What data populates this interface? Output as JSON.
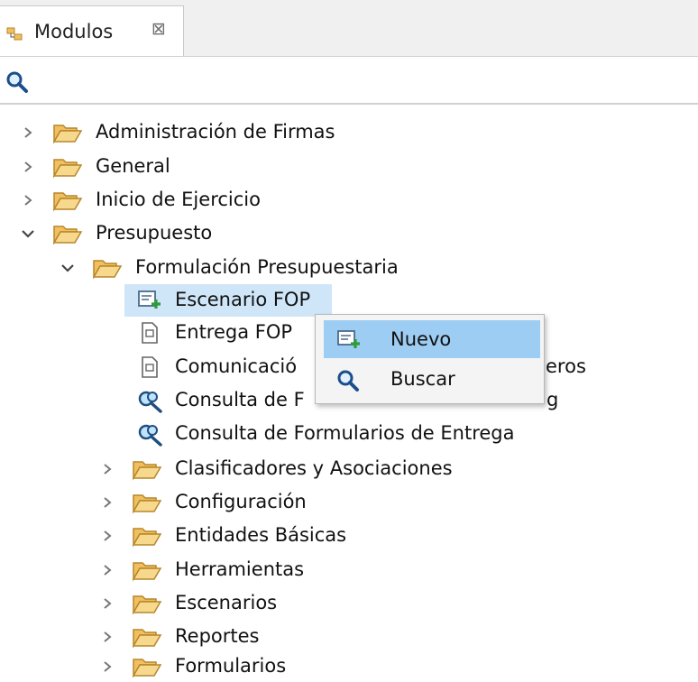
{
  "tab": {
    "title": "Modulos",
    "close_glyph": "⊠"
  },
  "search": {
    "value": "",
    "placeholder": ""
  },
  "tree": {
    "root": [
      {
        "label": "Administración de Firmas",
        "expanded": false,
        "icon": "folder-open-icon"
      },
      {
        "label": "General",
        "expanded": false,
        "icon": "folder-open-icon"
      },
      {
        "label": "Inicio de Ejercicio",
        "expanded": false,
        "icon": "folder-open-icon"
      },
      {
        "label": "Presupuesto",
        "expanded": true,
        "icon": "folder-open-icon"
      }
    ],
    "presupuesto_children": [
      {
        "label": "Formulación Presupuestaria",
        "expanded": true,
        "icon": "folder-open-icon"
      }
    ],
    "formulacion_children": [
      {
        "label": "Escenario FOP",
        "icon": "new-entry-icon",
        "selected": true
      },
      {
        "label": "Entrega FOP",
        "icon": "document-icon"
      },
      {
        "label": "Comunicació",
        "icon": "document-icon"
      },
      {
        "label": "Consulta de F",
        "icon": "search-binoculars-icon"
      },
      {
        "label": "Consulta de Formularios de Entrega",
        "icon": "search-binoculars-icon"
      }
    ],
    "partial_hidden": {
      "label_tail_1": "eros",
      "label_tail_2": "g"
    },
    "more_folders": [
      {
        "label": "Clasificadores y Asociaciones"
      },
      {
        "label": "Configuración"
      },
      {
        "label": "Entidades Básicas"
      },
      {
        "label": "Herramientas"
      },
      {
        "label": "Escenarios"
      },
      {
        "label": "Reportes"
      },
      {
        "label": "Formularios"
      }
    ]
  },
  "context_menu": {
    "items": [
      {
        "label": "Nuevo",
        "icon": "new-entry-icon",
        "highlighted": true
      },
      {
        "label": "Buscar",
        "icon": "search-icon",
        "highlighted": false
      }
    ]
  },
  "colors": {
    "selection": "#cfe6f8",
    "menu_highlight": "#9ecdf3",
    "folder": "#f0c060",
    "folder_stroke": "#b8862a"
  }
}
